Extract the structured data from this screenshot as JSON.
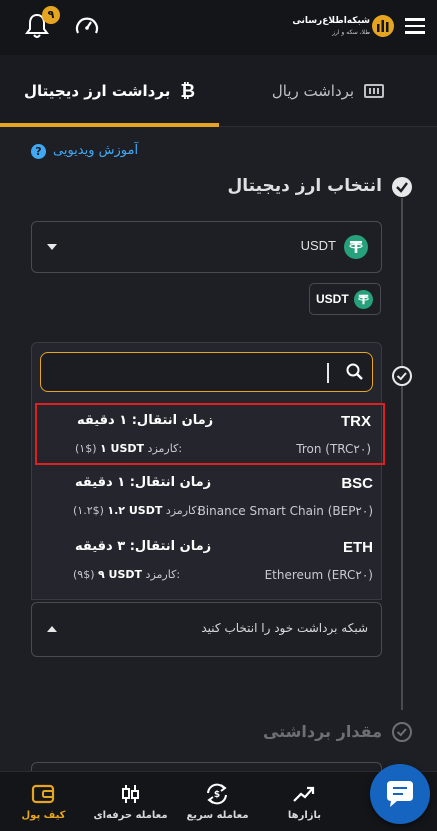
{
  "header": {
    "notification_count": "۹",
    "logo_title": "شبکه‌اطلاع‌رسانی",
    "logo_subtitle": "طلا، سکه و ارز"
  },
  "tabs": [
    {
      "label": "برداشت ارز دیجیتال",
      "active": true
    },
    {
      "label": "برداشت ریال",
      "active": false
    }
  ],
  "video_tutorial": "آموزش ویدیویی",
  "steps": {
    "select_crypto": "انتخاب ارز دیجیتال",
    "amount": "مقدار برداشتی"
  },
  "currency_select": {
    "value": "USDT",
    "chip": "USDT"
  },
  "network_search": {
    "value": "",
    "placeholder": ""
  },
  "networks": [
    {
      "name": "TRX",
      "full": "Tron (TRC۲۰)",
      "time": "زمان انتقال: ۱ دقیقه",
      "fee_label": "کارمزد:",
      "fee_amount": "۱ USDT",
      "fee_usd": "(۱$)",
      "highlighted": true
    },
    {
      "name": "BSC",
      "full": "Binance Smart Chain (BEP۲۰)",
      "time": "زمان انتقال: ۱ دقیقه",
      "fee_label": "کارمزد:",
      "fee_amount": "۱.۲ USDT",
      "fee_usd": "(۱.۲$)",
      "highlighted": false
    },
    {
      "name": "ETH",
      "full": "Ethereum (ERC۲۰)",
      "time": "زمان انتقال: ۳ دقیقه",
      "fee_label": "کارمزد:",
      "fee_amount": "۹ USDT",
      "fee_usd": "(۹$)",
      "highlighted": false
    }
  ],
  "network_hint": "شبکه برداشت خود را انتخاب کنید",
  "bottom_nav": [
    {
      "label": "کیف پول",
      "active": true
    },
    {
      "label": "معامله حرفه‌ای",
      "active": false
    },
    {
      "label": "معامله سریع",
      "active": false
    },
    {
      "label": "بازارها",
      "active": false
    }
  ],
  "colors": {
    "accent": "#e6a520",
    "highlight_border": "#e02020",
    "tether_green": "#26a17b",
    "link_blue": "#3fa9f5"
  }
}
